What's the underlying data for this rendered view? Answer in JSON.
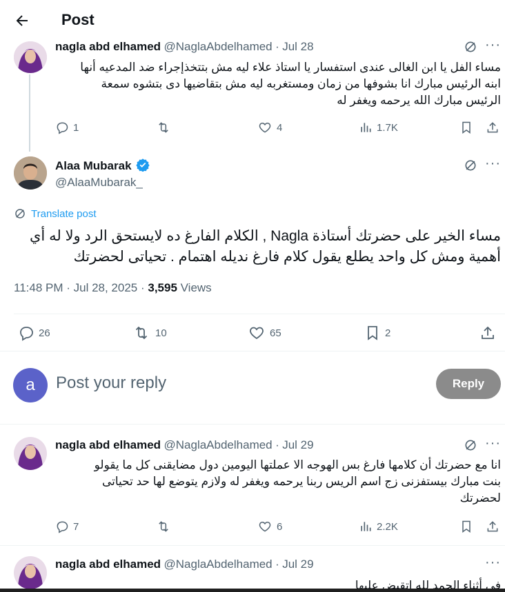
{
  "header": {
    "title": "Post"
  },
  "parent_tweet": {
    "name": "nagla abd elhamed",
    "handle": "@NaglaAbdelhamed",
    "sep": "·",
    "date": "Jul 28",
    "lines": [
      "مساء الفل يا ابن الغالى عندى استفسار يا استاذ علاء ليه مش بتتخذإجراء ضد المدعيه أنها",
      "ابنه الرئيس مبارك انا بشوفها من زمان ومستغربه ليه مش بتقاضيها دى بتشوه سمعة",
      "الرئيس مبارك الله يرحمه ويغفر له"
    ],
    "replies": "1",
    "likes": "4",
    "views": "1.7K"
  },
  "main_tweet": {
    "name": "Alaa Mubarak",
    "handle": "@AlaaMubarak_",
    "translate": "Translate post",
    "lines": [
      "مساء الخير على حضرتك أستاذة Nagla , الكلام الفارغ ده لايستحق الرد ولا له أي",
      "أهمية ومش كل واحد يطلع يقول كلام فارغ نديله اهتمام . تحياتى لحضرتك"
    ],
    "timestamp": "11:48 PM · Jul 28, 2025 · ",
    "views_count": "3,595",
    "views_label": " Views",
    "replies": "26",
    "reposts": "10",
    "likes": "65",
    "bookmarks": "2"
  },
  "reply_box": {
    "avatar_letter": "a",
    "placeholder": "Post your reply",
    "button": "Reply"
  },
  "reply1": {
    "name": "nagla abd elhamed",
    "handle": "@NaglaAbdelhamed",
    "sep": "·",
    "date": "Jul 29",
    "lines": [
      "انا مع حضرتك أن كلامها فارغ بس الهوجه الا عملتها اليومين دول  مضايقنى كل ما يقولو",
      "بنت مبارك  بيستفزنى زج اسم الريس ربنا يرحمه ويغفر له ولازم يتوضع لها حد تحياتى",
      "لحضرتك"
    ],
    "replies": "7",
    "likes": "6",
    "views": "2.2K"
  },
  "reply2": {
    "name": "nagla abd elhamed",
    "handle": "@NaglaAbdelhamed",
    "sep": "·",
    "date": "Jul 29",
    "line": "فى أثناء الحمد لله اتقبض عليها"
  },
  "colors": {
    "accent": "#1d9bf0",
    "reply_button": "#8b8b8b",
    "avatar_a": "#5b62c9"
  }
}
